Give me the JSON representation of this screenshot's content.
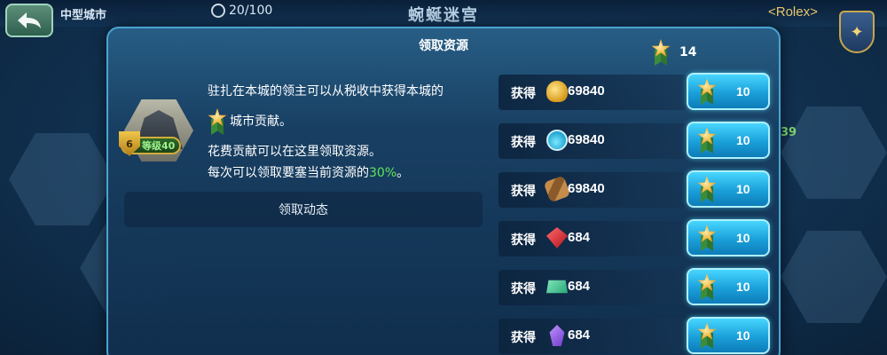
{
  "header": {
    "city_type": "中型城市",
    "flags": "20/100",
    "title": "蜿蜒迷宫",
    "player": "<Rolex>",
    "side_number": "39"
  },
  "dialog": {
    "title": "领取资源",
    "medal_total": "14",
    "building_level": "等级40",
    "desc_line1": "驻扎在本城的领主可以从税收中获得本城的",
    "desc_line2": "城市贡献。",
    "desc_line3": "花费贡献可以在这里领取资源。",
    "desc_line4_prefix": "每次可以领取要塞当前资源的",
    "desc_line4_pct": "30%",
    "desc_line4_suffix": "。",
    "log_button": "领取动态",
    "rows": [
      {
        "label": "获得",
        "icon": "gold-coins-icon",
        "amount": "69840",
        "cost": "10"
      },
      {
        "label": "获得",
        "icon": "elixir-flask-icon",
        "amount": "69840",
        "cost": "10"
      },
      {
        "label": "获得",
        "icon": "wood-logs-icon",
        "amount": "69840",
        "cost": "10"
      },
      {
        "label": "获得",
        "icon": "ruby-gem-icon",
        "amount": "684",
        "cost": "10"
      },
      {
        "label": "获得",
        "icon": "jade-bar-icon",
        "amount": "684",
        "cost": "10"
      },
      {
        "label": "获得",
        "icon": "purple-crystal-icon",
        "amount": "684",
        "cost": "10"
      }
    ]
  }
}
